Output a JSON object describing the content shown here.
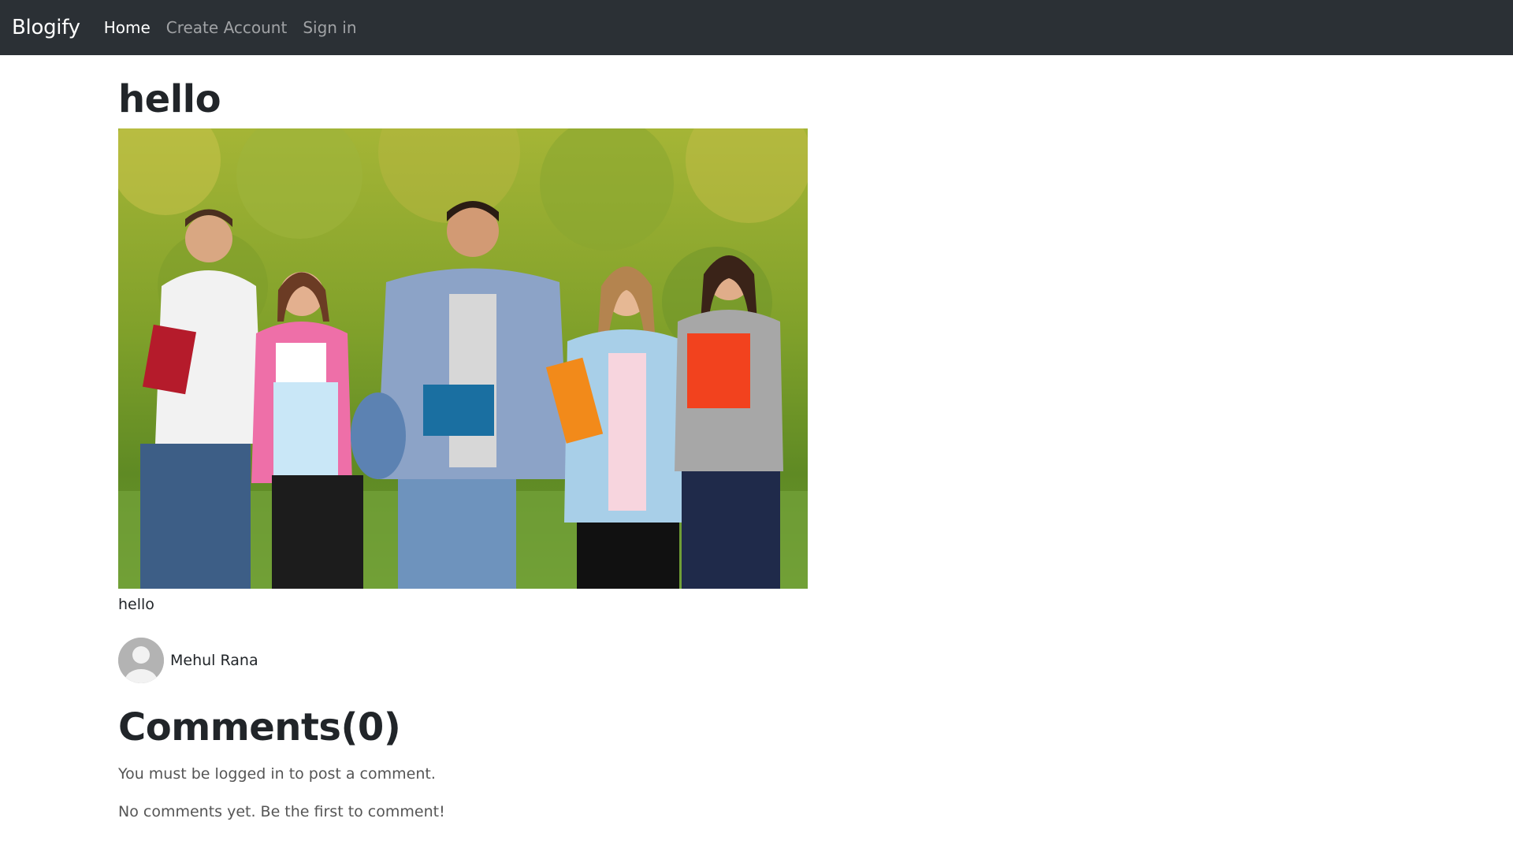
{
  "navbar": {
    "brand": "Blogify",
    "links": [
      {
        "label": "Home",
        "active": true
      },
      {
        "label": "Create Account",
        "active": false
      },
      {
        "label": "Sign in",
        "active": false
      }
    ]
  },
  "post": {
    "title": "hello",
    "image_icon": "group-of-students-photo",
    "caption": "hello",
    "author": {
      "name": "Mehul Rana",
      "avatar_icon": "default-user-avatar"
    }
  },
  "comments": {
    "title": "Comments(0)",
    "login_notice": "You must be logged in to post a comment.",
    "empty_notice": "No comments yet. Be the first to comment!"
  },
  "colors": {
    "navbar_bg": "#2b3035",
    "text": "#212529",
    "muted": "#555555"
  }
}
